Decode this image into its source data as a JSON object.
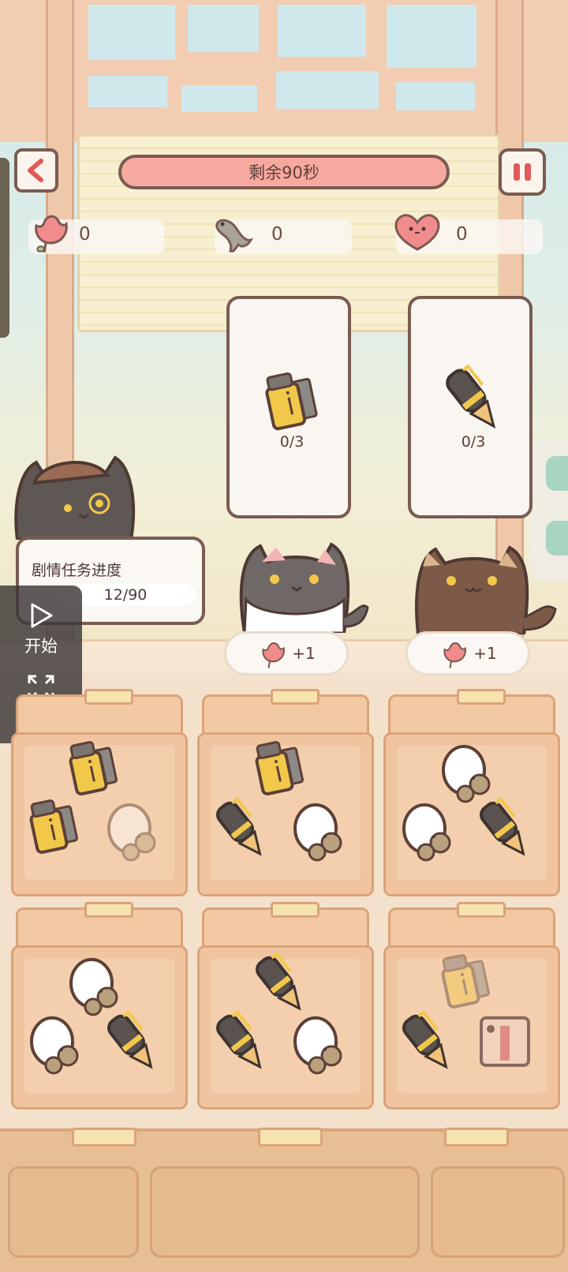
{
  "header": {
    "timer_text": "剩余90秒"
  },
  "resources": [
    {
      "icon": "flower-icon",
      "value": "0"
    },
    {
      "icon": "fish-icon",
      "value": "0"
    },
    {
      "icon": "heart-icon",
      "value": "0"
    }
  ],
  "orders": [
    {
      "item": "lighter",
      "progress": "0/3",
      "reward_icon": "flower-icon",
      "reward": "+1"
    },
    {
      "item": "pen",
      "progress": "0/3",
      "reward_icon": "flower-icon",
      "reward": "+1"
    }
  ],
  "story": {
    "title": "剧情任务进度",
    "progress": "12/90"
  },
  "side_controls": {
    "start_label": "开始",
    "expand_label": "展开"
  },
  "boxes": [
    {
      "items": [
        "lighter",
        "lighter",
        "mouse-faded"
      ]
    },
    {
      "items": [
        "lighter",
        "pen",
        "mouse"
      ]
    },
    {
      "items": [
        "mouse",
        "mouse",
        "pen"
      ]
    },
    {
      "items": [
        "mouse",
        "mouse",
        "pen"
      ]
    },
    {
      "items": [
        "pen",
        "pen",
        "mouse"
      ]
    },
    {
      "items": [
        "lighter-faded",
        "pen",
        "stamp-box"
      ]
    }
  ],
  "colors": {
    "accent": "#e15a5a",
    "timer_bar": "#f7a9a0",
    "outline": "#7a5b52"
  }
}
